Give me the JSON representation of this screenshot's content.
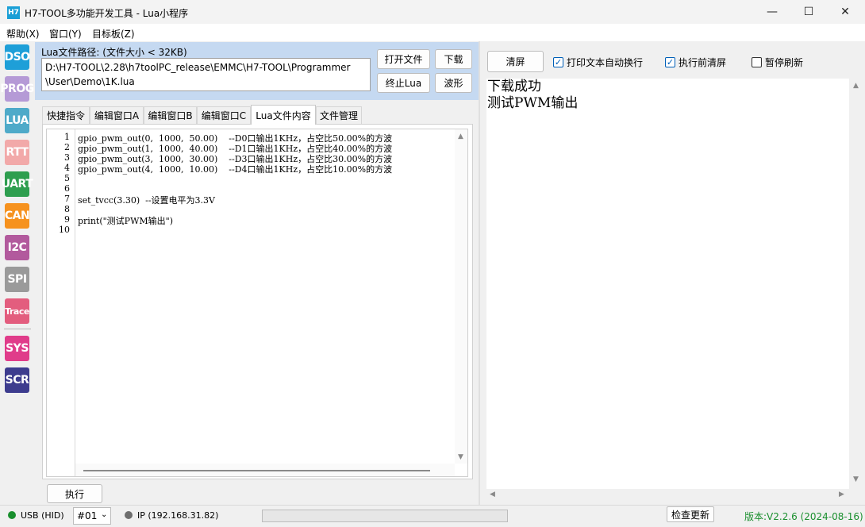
{
  "window": {
    "icon_text": "H7",
    "title": "H7-TOOL多功能开发工具 - Lua小程序",
    "minimize": "—",
    "maximize": "☐",
    "close": "✕"
  },
  "menu": [
    "帮助(X)",
    "窗口(Y)",
    "目标板(Z)"
  ],
  "sidebar": {
    "items": [
      {
        "label": "DSO",
        "color": "#1e9fd8"
      },
      {
        "label": "PROG",
        "color": "#b59ad6"
      },
      {
        "label": "LUA",
        "color": "#4eaac9"
      },
      {
        "label": "RTT",
        "color": "#f2a9a9"
      },
      {
        "label": "UART",
        "color": "#2e9e4f"
      },
      {
        "label": "CAN",
        "color": "#f6921e"
      },
      {
        "label": "I2C",
        "color": "#b25a9d"
      },
      {
        "label": "SPI",
        "color": "#9a9a9a"
      },
      {
        "label": "Trace",
        "color": "#e35d7e"
      },
      {
        "label": "SYS",
        "color": "#e03c8a"
      },
      {
        "label": "SCR",
        "color": "#3d3c8e"
      }
    ]
  },
  "lua_file": {
    "path_label": "Lua文件路径: (文件大小 < 32KB)",
    "path_line1": "D:\\H7-TOOL\\2.28\\h7toolPC_release\\EMMC\\H7-TOOL\\Programmer",
    "path_line2": "\\User\\Demo\\1K.lua",
    "open_button": "打开文件",
    "download_button": "下载",
    "stop_button": "终止Lua",
    "waveform_button": "波形"
  },
  "tabs": [
    {
      "label": "快捷指令"
    },
    {
      "label": "编辑窗口A"
    },
    {
      "label": "编辑窗口B"
    },
    {
      "label": "编辑窗口C"
    },
    {
      "label": "Lua文件内容"
    },
    {
      "label": "文件管理"
    }
  ],
  "active_tab": "Lua文件内容",
  "code_lines": [
    {
      "n": "1",
      "text": "gpio_pwm_out(0,  1000,  50.00)    --D0口输出1KHz，占空比50.00%的方波"
    },
    {
      "n": "2",
      "text": "gpio_pwm_out(1,  1000,  40.00)    --D1口输出1KHz，占空比40.00%的方波"
    },
    {
      "n": "3",
      "text": "gpio_pwm_out(3,  1000,  30.00)    --D3口输出1KHz，占空比30.00%的方波"
    },
    {
      "n": "4",
      "text": "gpio_pwm_out(4,  1000,  10.00)    --D4口输出1KHz，占空比10.00%的方波"
    },
    {
      "n": "5",
      "text": ""
    },
    {
      "n": "6",
      "text": ""
    },
    {
      "n": "7",
      "text": "set_tvcc(3.30)  --设置电平为3.3V"
    },
    {
      "n": "8",
      "text": ""
    },
    {
      "n": "9",
      "text": "print(\"测试PWM输出\")"
    },
    {
      "n": "10",
      "text": ""
    }
  ],
  "execute_button": "执行",
  "output": {
    "clear_button": "清屏",
    "wrap_checkbox": "打印文本自动换行",
    "wrap_checked": true,
    "clear_before_checkbox": "执行前清屏",
    "clear_before_checked": true,
    "pause_checkbox": "暂停刷新",
    "pause_checked": false,
    "lines": [
      "下载成功",
      "测试PWM输出"
    ]
  },
  "status": {
    "usb": "USB (HID)",
    "usb_color": "#1a8f2e",
    "port": "#01",
    "ip": "IP (192.168.31.82)",
    "ip_color": "#6e6e6e",
    "update_button": "检查更新",
    "version": "版本:V2.2.6 (2024-08-16)",
    "version_color": "#1a8f2e"
  }
}
